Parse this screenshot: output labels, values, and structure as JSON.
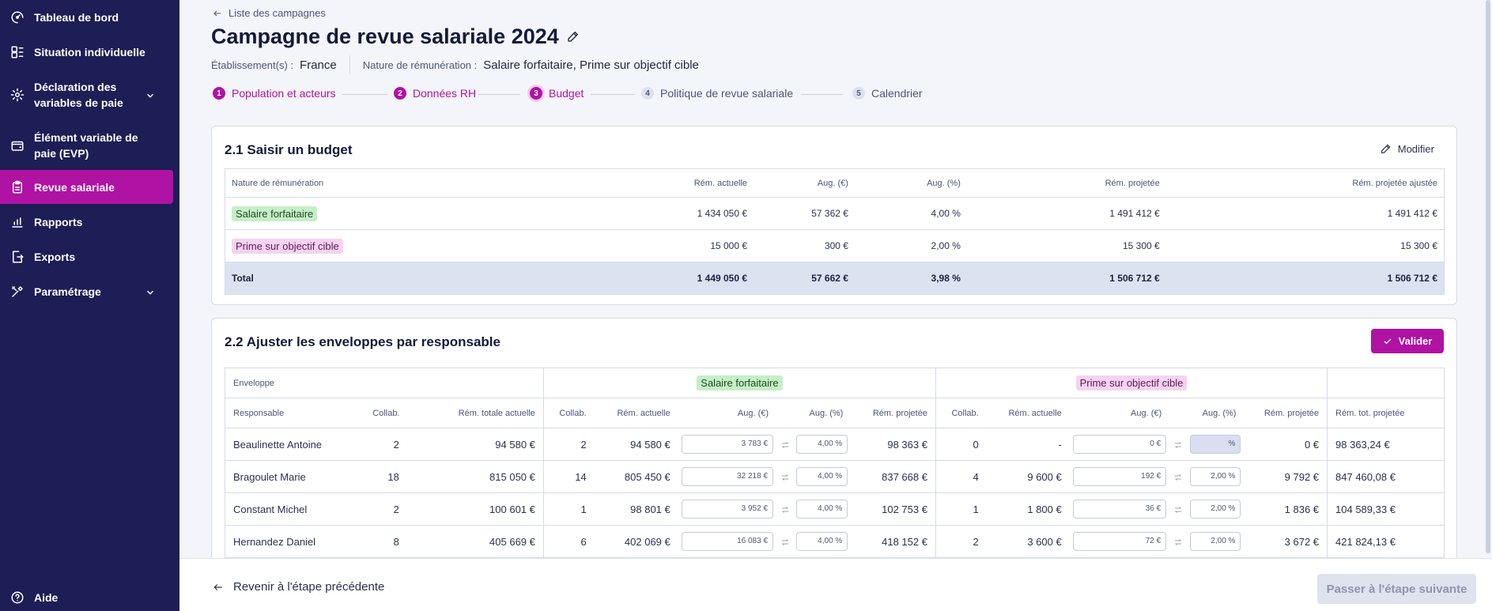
{
  "sidebar": {
    "items": [
      {
        "label": "Tableau de bord",
        "icon": "gauge-icon"
      },
      {
        "label": "Situation individuelle",
        "icon": "layout-icon"
      },
      {
        "label": "Déclaration des variables de paie",
        "icon": "cog-icon"
      },
      {
        "label": "Élément variable de paie (EVP)",
        "icon": "wallet-icon"
      },
      {
        "label": "Revue salariale",
        "icon": "clipboard-icon"
      },
      {
        "label": "Rapports",
        "icon": "bar-chart-icon"
      },
      {
        "label": "Exports",
        "icon": "export-icon"
      },
      {
        "label": "Paramétrage",
        "icon": "tools-icon"
      }
    ],
    "help_label": "Aide"
  },
  "header": {
    "back_label": "Liste des campagnes",
    "title": "Campagne de revue salariale 2024",
    "establishment_label": "Établissement(s) :",
    "establishment_value": "France",
    "nature_label": "Nature de rémunération :",
    "nature_value": "Salaire forfaitaire, Prime sur objectif cible"
  },
  "steps": [
    {
      "num": "1",
      "label": "Population et acteurs",
      "state": "done"
    },
    {
      "num": "2",
      "label": "Données RH",
      "state": "done"
    },
    {
      "num": "3",
      "label": "Budget",
      "state": "current"
    },
    {
      "num": "4",
      "label": "Politique de revue salariale",
      "state": "todo"
    },
    {
      "num": "5",
      "label": "Calendrier",
      "state": "todo"
    }
  ],
  "budget": {
    "title": "2.1 Saisir un budget",
    "modify_label": "Modifier",
    "headers": [
      "Nature de rémunération",
      "Rém. actuelle",
      "Aug. (€)",
      "Aug. (%)",
      "Rém. projetée",
      "Rém. projetée ajustée"
    ],
    "rows": [
      {
        "nature": "Salaire forfaitaire",
        "actuelle": "1 434 050 €",
        "aug_eur": "57 362 €",
        "aug_pct": "4,00 %",
        "projetee": "1 491 412 €",
        "ajustee": "1 491 412 €"
      },
      {
        "nature": "Prime sur objectif cible",
        "actuelle": "15 000 €",
        "aug_eur": "300 €",
        "aug_pct": "2,00 %",
        "projetee": "15 300 €",
        "ajustee": "15 300 €"
      }
    ],
    "total": {
      "label": "Total",
      "actuelle": "1 449 050 €",
      "aug_eur": "57 662 €",
      "aug_pct": "3,98 %",
      "projetee": "1 506 712 €",
      "ajustee": "1 506 712 €"
    }
  },
  "envelopes": {
    "title": "2.2 Ajuster les enveloppes par responsable",
    "validate_label": "Valider",
    "group_envelope": "Enveloppe",
    "group_salaire": "Salaire forfaitaire",
    "group_prime": "Prime sur objectif cible",
    "headers": {
      "responsable": "Responsable",
      "collab": "Collab.",
      "rem_totale": "Rém. totale actuelle",
      "s_collab": "Collab.",
      "s_rem": "Rém. actuelle",
      "s_aug_eur": "Aug. (€)",
      "s_aug_pct": "Aug. (%)",
      "s_proj": "Rém. projetée",
      "p_collab": "Collab.",
      "p_rem": "Rém. actuelle",
      "p_aug_eur": "Aug. (€)",
      "p_aug_pct": "Aug. (%)",
      "p_proj": "Rém. projetée",
      "tot_proj": "Rém. tot. projetée"
    },
    "rows": [
      {
        "name": "Beaulinette Antoine",
        "collab": "2",
        "rem_totale": "94 580 €",
        "s_collab": "2",
        "s_rem": "94 580 €",
        "s_aug_eur": "3 783 €",
        "s_aug_pct": "4,00 %",
        "s_proj": "98 363 €",
        "p_collab": "0",
        "p_rem": "-",
        "p_aug_eur": "0 €",
        "p_aug_pct": "%",
        "p_proj": "0 €",
        "tot_proj": "98 363,24 €"
      },
      {
        "name": "Bragoulet Marie",
        "collab": "18",
        "rem_totale": "815 050 €",
        "s_collab": "14",
        "s_rem": "805 450 €",
        "s_aug_eur": "32 218 €",
        "s_aug_pct": "4,00 %",
        "s_proj": "837 668 €",
        "p_collab": "4",
        "p_rem": "9 600 €",
        "p_aug_eur": "192 €",
        "p_aug_pct": "2,00 %",
        "p_proj": "9 792 €",
        "tot_proj": "847 460,08 €"
      },
      {
        "name": "Constant Michel",
        "collab": "2",
        "rem_totale": "100 601 €",
        "s_collab": "1",
        "s_rem": "98 801 €",
        "s_aug_eur": "3 952 €",
        "s_aug_pct": "4,00 %",
        "s_proj": "102 753 €",
        "p_collab": "1",
        "p_rem": "1 800 €",
        "p_aug_eur": "36 €",
        "p_aug_pct": "2,00 %",
        "p_proj": "1 836 €",
        "tot_proj": "104 589,33 €"
      },
      {
        "name": "Hernandez Daniel",
        "collab": "8",
        "rem_totale": "405 669 €",
        "s_collab": "6",
        "s_rem": "402 069 €",
        "s_aug_eur": "16 083 €",
        "s_aug_pct": "4,00 %",
        "s_proj": "418 152 €",
        "p_collab": "2",
        "p_rem": "3 600 €",
        "p_aug_eur": "72 €",
        "p_aug_pct": "2,00 %",
        "p_proj": "3 672 €",
        "tot_proj": "421 824,13 €"
      }
    ]
  },
  "footer": {
    "prev_label": "Revenir à l'étape précédente",
    "next_label": "Passer à l'étape suivante"
  },
  "colors": {
    "sidebar_bg": "#1d1e55",
    "accent": "#b012a3",
    "page_bg": "#f3f5fa"
  }
}
